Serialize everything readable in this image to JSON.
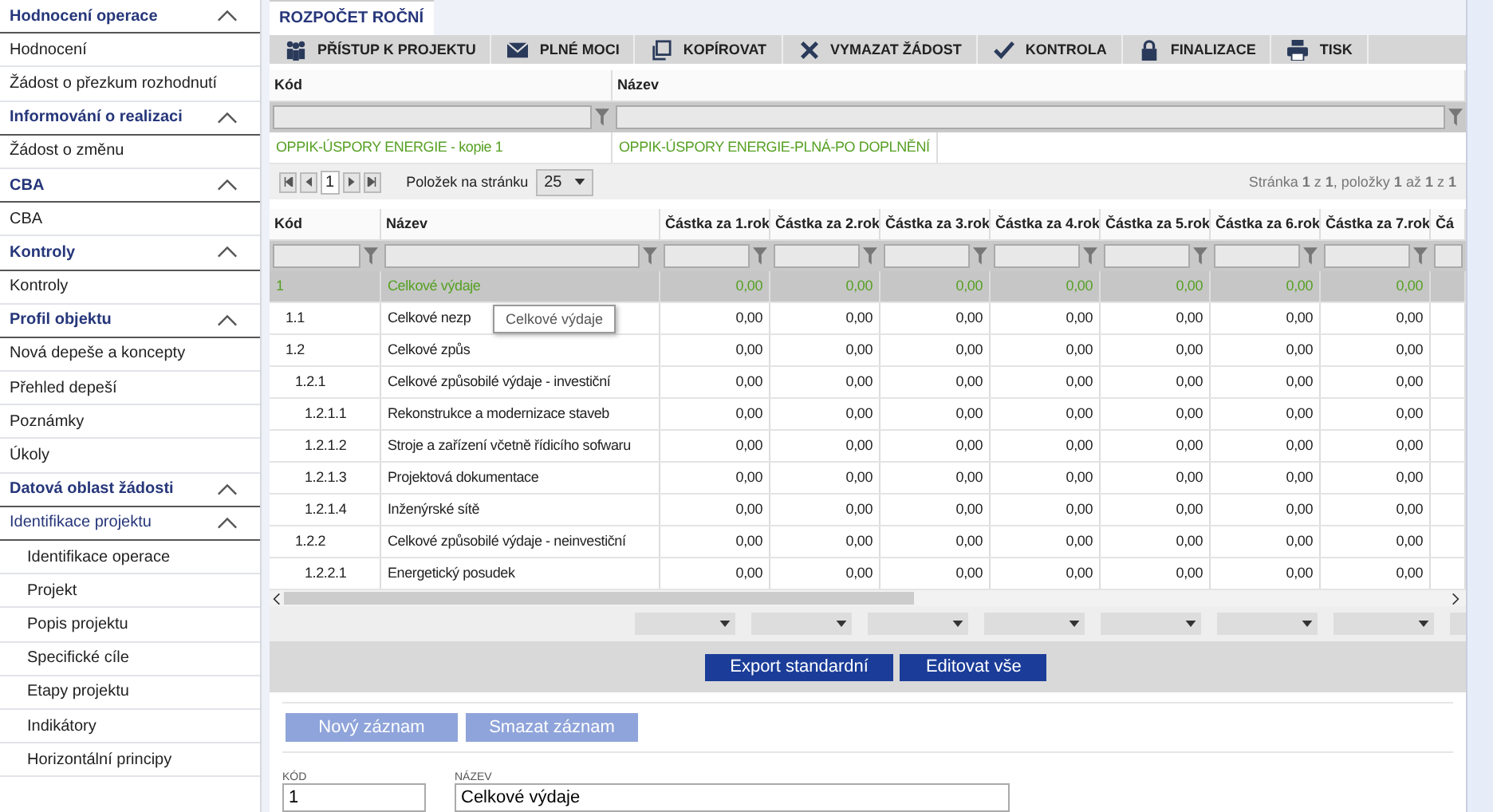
{
  "sidebar": {
    "sections": [
      {
        "title": "Hodnocení operace",
        "expanded": true,
        "items": [
          {
            "label": "Hodnocení"
          },
          {
            "label": "Žádost o přezkum rozhodnutí"
          }
        ]
      },
      {
        "title": "Informování o realizaci",
        "expanded": true,
        "items": [
          {
            "label": "Žádost o změnu"
          }
        ]
      },
      {
        "title": "CBA",
        "expanded": true,
        "items": [
          {
            "label": "CBA"
          }
        ]
      },
      {
        "title": "Kontroly",
        "expanded": true,
        "items": [
          {
            "label": "Kontroly"
          }
        ]
      },
      {
        "title": "Profil objektu",
        "expanded": true,
        "items": [
          {
            "label": "Nová depeše a koncepty"
          },
          {
            "label": "Přehled depeší"
          },
          {
            "label": "Poznámky"
          },
          {
            "label": "Úkoly"
          }
        ]
      },
      {
        "title": "Datová oblast žádosti",
        "expanded": true,
        "items": [
          {
            "label": "Identifikace projektu",
            "expanded": true,
            "children": [
              {
                "label": "Identifikace operace"
              },
              {
                "label": "Projekt"
              },
              {
                "label": "Popis projektu"
              },
              {
                "label": "Specifické cíle"
              },
              {
                "label": "Etapy projektu"
              },
              {
                "label": "Indikátory"
              },
              {
                "label": "Horizontální principy"
              }
            ]
          }
        ]
      }
    ]
  },
  "tab": {
    "label": "ROZPOČET ROČNÍ",
    "selected": true
  },
  "toolbar": [
    {
      "label": "PŘÍSTUP K PROJEKTU"
    },
    {
      "label": "PLNÉ MOCI"
    },
    {
      "label": "KOPÍROVAT"
    },
    {
      "label": "VYMAZAT ŽÁDOST"
    },
    {
      "label": "KONTROLA"
    },
    {
      "label": "FINALIZACE"
    },
    {
      "label": "TISK"
    }
  ],
  "budget_table": {
    "columns": [
      "Kód",
      "Název"
    ],
    "rows": [
      {
        "cells": [
          "OPPIK-ÚSPORY ENERGIE - kopie 1",
          "OPPIK-ÚSPORY ENERGIE-PLNÁ-PO DOPLNĚNÍ"
        ],
        "selected": true
      }
    ],
    "pager": {
      "page": "1",
      "page_size_label": "Položek na stránku",
      "page_size": "25",
      "summary": "Stránka **1** z **1**, položky **1** až **1** z **1**"
    }
  },
  "items_table": {
    "columns": [
      "Kód",
      "Název",
      "Částka za 1.rok",
      "Částka za 2.rok",
      "Částka za 3.rok",
      "Částka za 4.rok",
      "Částka za 5.rok",
      "Částka za 6.rok",
      "Částka za 7.rok",
      "Čá"
    ],
    "rows": [
      {
        "code": "1",
        "name": "Celkové výdaje",
        "values": [
          "0,00",
          "0,00",
          "0,00",
          "0,00",
          "0,00",
          "0,00",
          "0,00"
        ],
        "selected": true
      },
      {
        "code": "1.1",
        "name": "Celkové nezp",
        "values": [
          "0,00",
          "0,00",
          "0,00",
          "0,00",
          "0,00",
          "0,00",
          "0,00"
        ],
        "selected": false
      },
      {
        "code": "1.2",
        "name": "Celkové způs",
        "values": [
          "0,00",
          "0,00",
          "0,00",
          "0,00",
          "0,00",
          "0,00",
          "0,00"
        ],
        "selected": false
      },
      {
        "code": "1.2.1",
        "name": "Celkové způsobilé výdaje - investiční",
        "values": [
          "0,00",
          "0,00",
          "0,00",
          "0,00",
          "0,00",
          "0,00",
          "0,00"
        ],
        "selected": false
      },
      {
        "code": "1.2.1.1",
        "name": "Rekonstrukce a modernizace staveb",
        "values": [
          "0,00",
          "0,00",
          "0,00",
          "0,00",
          "0,00",
          "0,00",
          "0,00"
        ],
        "selected": false
      },
      {
        "code": "1.2.1.2",
        "name": "Stroje a zařízení včetně řídicího sofwaru",
        "values": [
          "0,00",
          "0,00",
          "0,00",
          "0,00",
          "0,00",
          "0,00",
          "0,00"
        ],
        "selected": false
      },
      {
        "code": "1.2.1.3",
        "name": "Projektová dokumentace",
        "values": [
          "0,00",
          "0,00",
          "0,00",
          "0,00",
          "0,00",
          "0,00",
          "0,00"
        ],
        "selected": false
      },
      {
        "code": "1.2.1.4",
        "name": "Inženýrské sítě",
        "values": [
          "0,00",
          "0,00",
          "0,00",
          "0,00",
          "0,00",
          "0,00",
          "0,00"
        ],
        "selected": false
      },
      {
        "code": "1.2.2",
        "name": "Celkové způsobilé výdaje - neinvestiční",
        "values": [
          "0,00",
          "0,00",
          "0,00",
          "0,00",
          "0,00",
          "0,00",
          "0,00"
        ],
        "selected": false
      },
      {
        "code": "1.2.2.1",
        "name": "Energetický posudek",
        "values": [
          "0,00",
          "0,00",
          "0,00",
          "0,00",
          "0,00",
          "0,00",
          "0,00"
        ],
        "selected": false
      }
    ],
    "tooltip": "Celkové výdaje"
  },
  "actions": [
    {
      "label": "Export standardní",
      "disabled": false
    },
    {
      "label": "Editovat vše",
      "disabled": false
    }
  ],
  "record_buttons": [
    {
      "label": "Nový záznam",
      "disabled": true
    },
    {
      "label": "Smazat záznam",
      "disabled": true
    }
  ],
  "form": {
    "fields": [
      {
        "label": "KÓD",
        "value": "1",
        "kind": "short"
      },
      {
        "label": "NÁZEV",
        "value": "Celkové výdaje",
        "kind": "wide"
      }
    ]
  }
}
